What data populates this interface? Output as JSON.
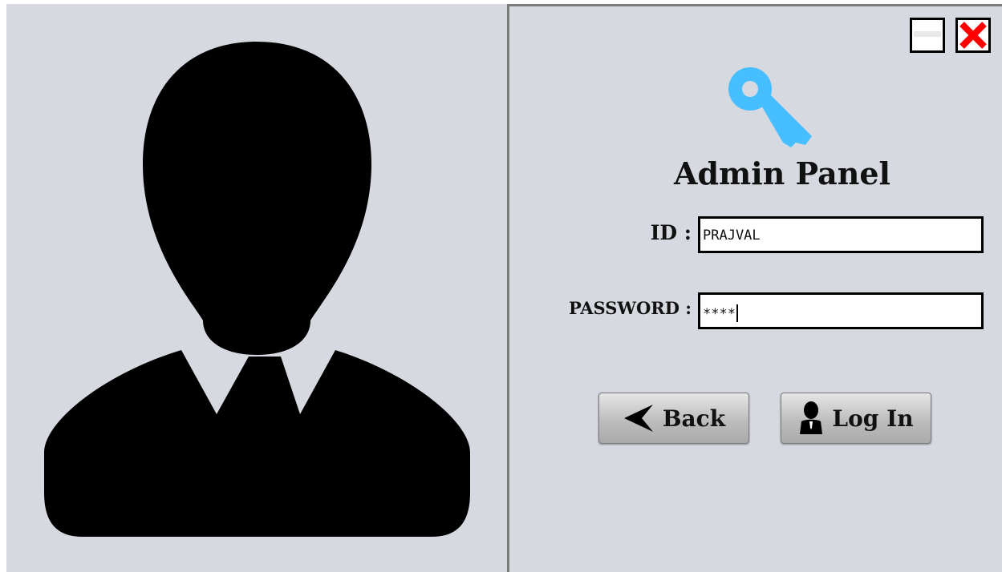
{
  "window": {
    "minimize_icon": "minimize-icon",
    "close_icon": "close-icon",
    "close_color": "#ff0000"
  },
  "avatar": {
    "icon": "user-silhouette-icon",
    "color": "#000000"
  },
  "header": {
    "icon": "key-icon",
    "icon_color": "#47beff",
    "title": "Admin Panel"
  },
  "form": {
    "id_label": "ID :",
    "id_value": "PRAJVAL",
    "password_label": "PASSWORD :",
    "password_value": "****"
  },
  "buttons": {
    "back_label": "Back",
    "back_icon": "arrow-left-icon",
    "login_label": "Log In",
    "login_icon": "user-icon"
  }
}
